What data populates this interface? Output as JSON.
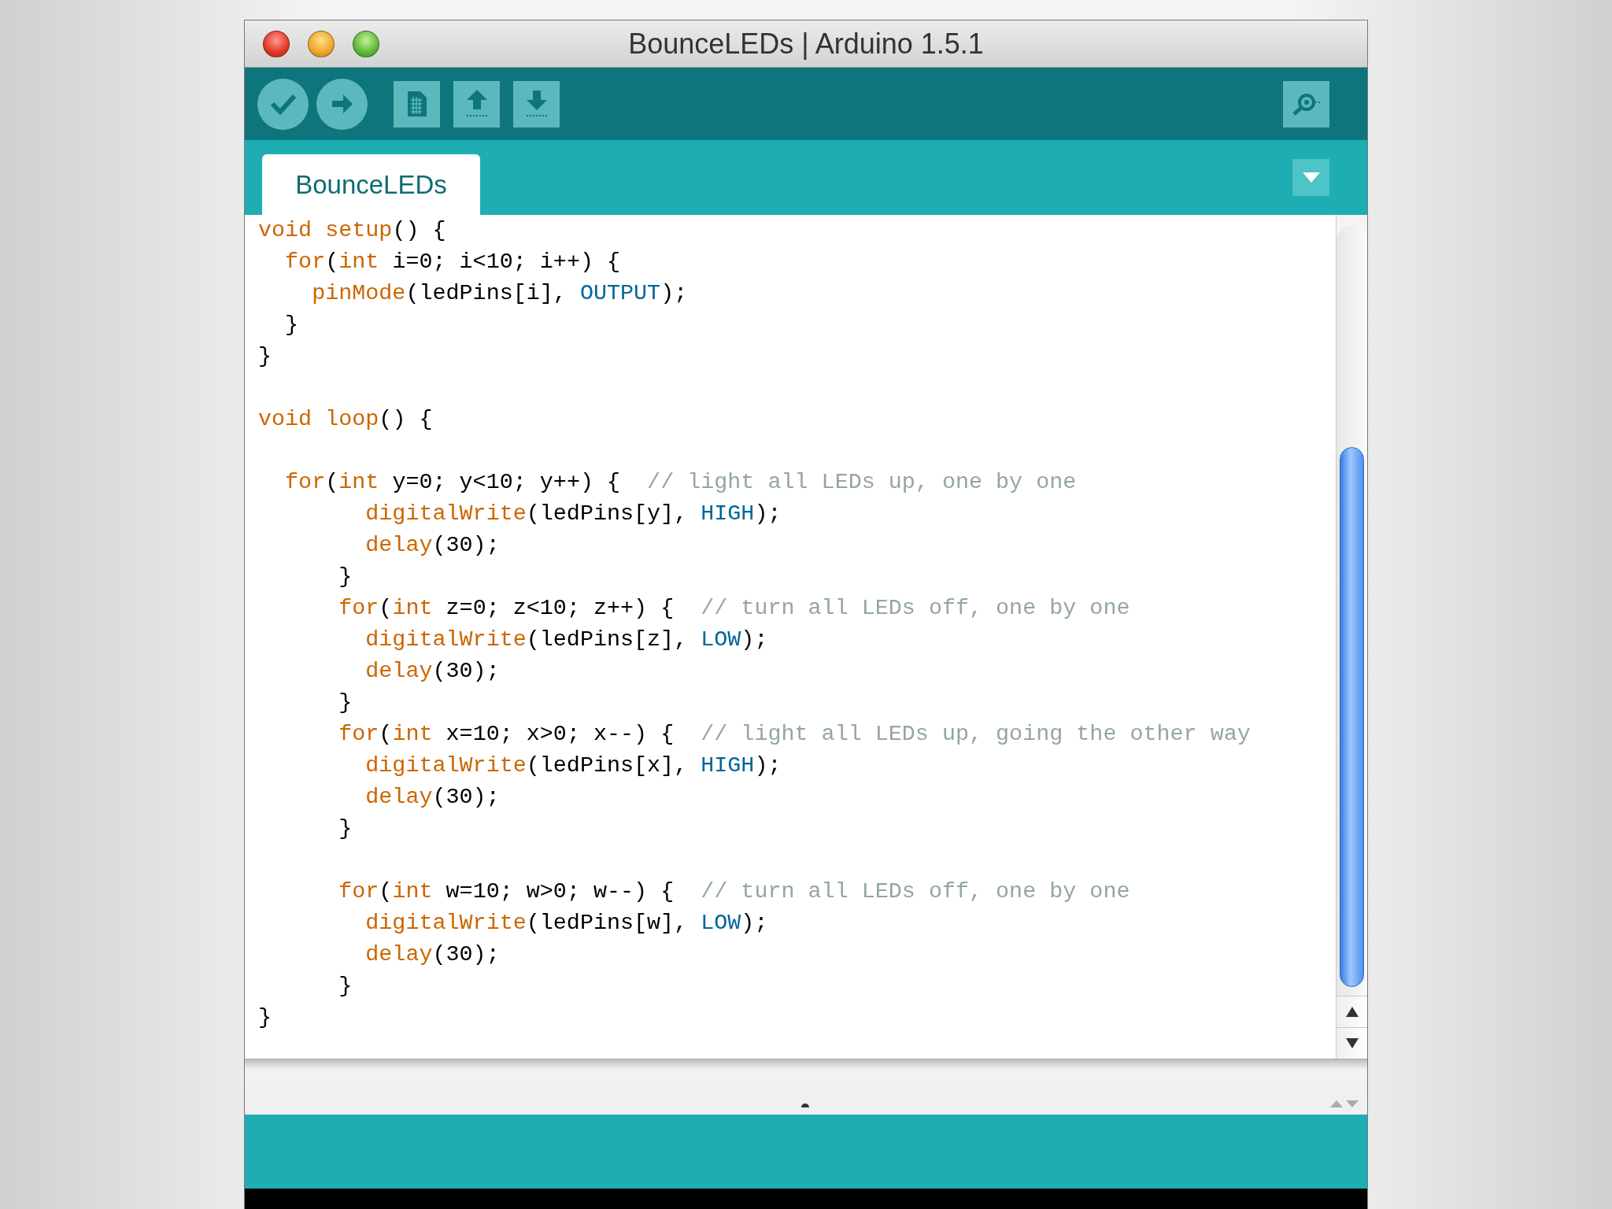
{
  "window": {
    "title": "BounceLEDs | Arduino 1.5.1"
  },
  "tabs": [
    {
      "label": "BounceLEDs",
      "selected": true
    }
  ],
  "editor": {
    "blocks": [
      [
        [
          {
            "kind": "keyword",
            "text": "void"
          },
          {
            "kind": "function",
            "text": " setup"
          },
          {
            "kind": "plain",
            "text": "() {"
          }
        ],
        [
          {
            "kind": "keyword",
            "text": "  for"
          },
          {
            "kind": "plain",
            "text": "("
          },
          {
            "kind": "keyword",
            "text": "int"
          },
          {
            "kind": "plain",
            "text": " i=0; i<10; i++) {"
          }
        ],
        [
          {
            "kind": "function",
            "text": "    pinMode"
          },
          {
            "kind": "plain",
            "text": "(ledPins[i], "
          },
          {
            "kind": "constant",
            "text": "OUTPUT"
          },
          {
            "kind": "plain",
            "text": ");"
          }
        ],
        [
          {
            "kind": "plain",
            "text": "  }"
          }
        ],
        [
          {
            "kind": "plain",
            "text": "}"
          }
        ]
      ],
      [
        [
          {
            "kind": "keyword",
            "text": "void"
          },
          {
            "kind": "function",
            "text": " loop"
          },
          {
            "kind": "plain",
            "text": "() {"
          }
        ]
      ],
      [
        [
          {
            "kind": "keyword",
            "text": "  for"
          },
          {
            "kind": "plain",
            "text": "("
          },
          {
            "kind": "keyword",
            "text": "int"
          },
          {
            "kind": "plain",
            "text": " y=0; y<10; y++) {"
          },
          {
            "kind": "comment",
            "text": "  // light all LEDs up, one by one"
          }
        ],
        [
          {
            "kind": "function",
            "text": "        digitalWrite"
          },
          {
            "kind": "plain",
            "text": "(ledPins[y], "
          },
          {
            "kind": "constant",
            "text": "HIGH"
          },
          {
            "kind": "plain",
            "text": ");"
          }
        ],
        [
          {
            "kind": "function",
            "text": "        delay"
          },
          {
            "kind": "plain",
            "text": "(30);"
          }
        ],
        [
          {
            "kind": "plain",
            "text": "      }"
          }
        ],
        [
          {
            "kind": "keyword",
            "text": "      for"
          },
          {
            "kind": "plain",
            "text": "("
          },
          {
            "kind": "keyword",
            "text": "int"
          },
          {
            "kind": "plain",
            "text": " z=0; z<10; z++) {"
          },
          {
            "kind": "comment",
            "text": "  // turn all LEDs off, one by one"
          }
        ],
        [
          {
            "kind": "function",
            "text": "        digitalWrite"
          },
          {
            "kind": "plain",
            "text": "(ledPins[z], "
          },
          {
            "kind": "constant",
            "text": "LOW"
          },
          {
            "kind": "plain",
            "text": ");"
          }
        ],
        [
          {
            "kind": "function",
            "text": "        delay"
          },
          {
            "kind": "plain",
            "text": "(30);"
          }
        ],
        [
          {
            "kind": "plain",
            "text": "      }"
          }
        ],
        [
          {
            "kind": "keyword",
            "text": "      for"
          },
          {
            "kind": "plain",
            "text": "("
          },
          {
            "kind": "keyword",
            "text": "int"
          },
          {
            "kind": "plain",
            "text": " x=10; x>0; x--) {"
          },
          {
            "kind": "comment",
            "text": "  // light all LEDs up, going the other way"
          }
        ],
        [
          {
            "kind": "function",
            "text": "        digitalWrite"
          },
          {
            "kind": "plain",
            "text": "(ledPins[x], "
          },
          {
            "kind": "constant",
            "text": "HIGH"
          },
          {
            "kind": "plain",
            "text": ");"
          }
        ],
        [
          {
            "kind": "function",
            "text": "        delay"
          },
          {
            "kind": "plain",
            "text": "(30);"
          }
        ],
        [
          {
            "kind": "plain",
            "text": "      }"
          }
        ]
      ],
      [
        [
          {
            "kind": "keyword",
            "text": "      for"
          },
          {
            "kind": "plain",
            "text": "("
          },
          {
            "kind": "keyword",
            "text": "int"
          },
          {
            "kind": "plain",
            "text": " w=10; w>0; w--) {"
          },
          {
            "kind": "comment",
            "text": "  // turn all LEDs off, one by one"
          }
        ],
        [
          {
            "kind": "function",
            "text": "        digitalWrite"
          },
          {
            "kind": "plain",
            "text": "(ledPins[w], "
          },
          {
            "kind": "constant",
            "text": "LOW"
          },
          {
            "kind": "plain",
            "text": ");"
          }
        ],
        [
          {
            "kind": "function",
            "text": "        delay"
          },
          {
            "kind": "plain",
            "text": "(30);"
          }
        ],
        [
          {
            "kind": "plain",
            "text": "      }"
          }
        ],
        [
          {
            "kind": "plain",
            "text": "}"
          }
        ]
      ]
    ]
  }
}
